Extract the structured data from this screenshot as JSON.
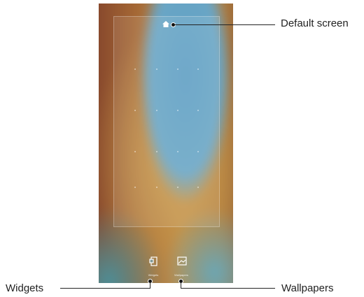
{
  "callouts": {
    "default_screen": "Default screen",
    "widgets": "Widgets",
    "wallpapers": "Wallpapers"
  },
  "dock": {
    "widgets_label": "Widgets",
    "wallpapers_label": "Wallpapers"
  },
  "icons": {
    "home": "home-icon",
    "widgets": "widgets-icon",
    "wallpapers": "wallpapers-icon"
  },
  "colors": {
    "callout_line": "#222222",
    "text": "#222222"
  }
}
